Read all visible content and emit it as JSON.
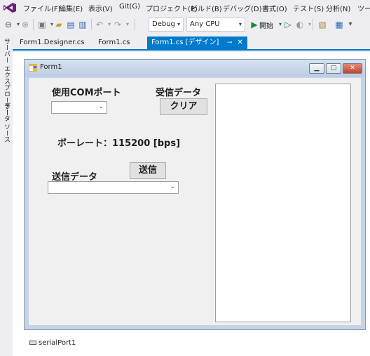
{
  "menu": {
    "items": [
      "ファイル(F)",
      "編集(E)",
      "表示(V)",
      "Git(G)",
      "プロジェクト(P)",
      "ビルド(B)",
      "デバッグ(D)",
      "書式(O)",
      "テスト(S)",
      "分析(N)",
      "ツー"
    ]
  },
  "toolbar": {
    "config": "Debug",
    "platform": "Any CPU",
    "start_label": "開始"
  },
  "side_strip": {
    "items": [
      "サーバー エクスプローラー",
      "データ ソース"
    ]
  },
  "tabs": [
    {
      "label": "Form1.Designer.cs",
      "active": false
    },
    {
      "label": "Form1.cs",
      "active": false
    },
    {
      "label": "Form1.cs [デザイン]",
      "active": true
    }
  ],
  "form": {
    "title": "Form1",
    "com_port_label": "使用COMポート",
    "com_port_value": "",
    "rx_label": "受信データ",
    "clear_button": "クリア",
    "baud_label": "ボーレート：115200 [bps]",
    "tx_label": "送信データ",
    "send_button": "送信",
    "tx_value": "",
    "rx_text": ""
  },
  "tray": {
    "component": "serialPort1"
  },
  "colors": {
    "accent": "#007acc",
    "background": "#eeeef2"
  }
}
